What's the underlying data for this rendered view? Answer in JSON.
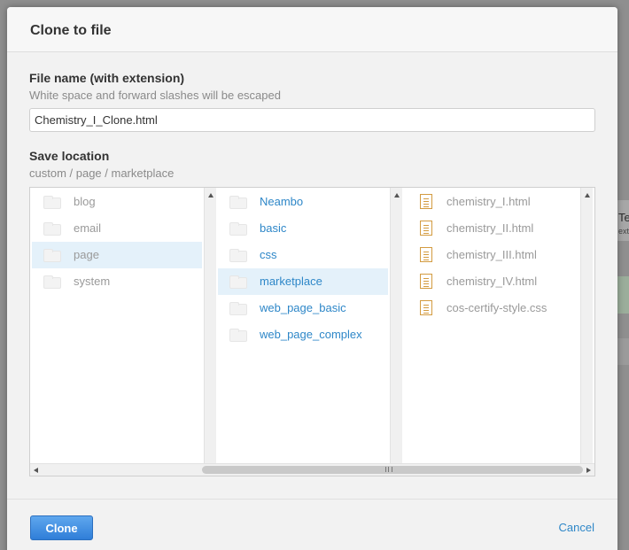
{
  "backdrop": {
    "fragment_1": "Te",
    "fragment_2": "ext"
  },
  "dialog": {
    "title": "Clone to file",
    "filename": {
      "label": "File name (with extension)",
      "hint": "White space and forward slashes will be escaped",
      "value": "Chemistry_I_Clone.html"
    },
    "location": {
      "label": "Save location",
      "path": "custom / page / marketplace"
    },
    "columns": {
      "root": [
        {
          "label": "blog",
          "icon": "folder-icon",
          "selected": false
        },
        {
          "label": "email",
          "icon": "folder-icon",
          "selected": false
        },
        {
          "label": "page",
          "icon": "folder-icon",
          "selected": true
        },
        {
          "label": "system",
          "icon": "folder-icon",
          "selected": false
        }
      ],
      "page": [
        {
          "label": "Neambo",
          "icon": "folder-icon",
          "selected": false
        },
        {
          "label": "basic",
          "icon": "folder-icon",
          "selected": false
        },
        {
          "label": "css",
          "icon": "folder-icon",
          "selected": false
        },
        {
          "label": "marketplace",
          "icon": "folder-icon",
          "selected": true
        },
        {
          "label": "web_page_basic",
          "icon": "folder-icon",
          "selected": false
        },
        {
          "label": "web_page_complex",
          "icon": "folder-icon",
          "selected": false
        }
      ],
      "marketplace": [
        {
          "label": "chemistry_I.html",
          "icon": "file-icon"
        },
        {
          "label": "chemistry_II.html",
          "icon": "file-icon"
        },
        {
          "label": "chemistry_III.html",
          "icon": "file-icon"
        },
        {
          "label": "chemistry_IV.html",
          "icon": "file-icon"
        },
        {
          "label": "cos-certify-style.css",
          "icon": "file-icon"
        }
      ]
    },
    "actions": {
      "clone_label": "Clone",
      "cancel_label": "Cancel"
    }
  },
  "colors": {
    "accent": "#2e87c8",
    "primary_button": "#3b8be0",
    "selected_row": "#e4f1fa",
    "file_icon": "#d39b40"
  }
}
